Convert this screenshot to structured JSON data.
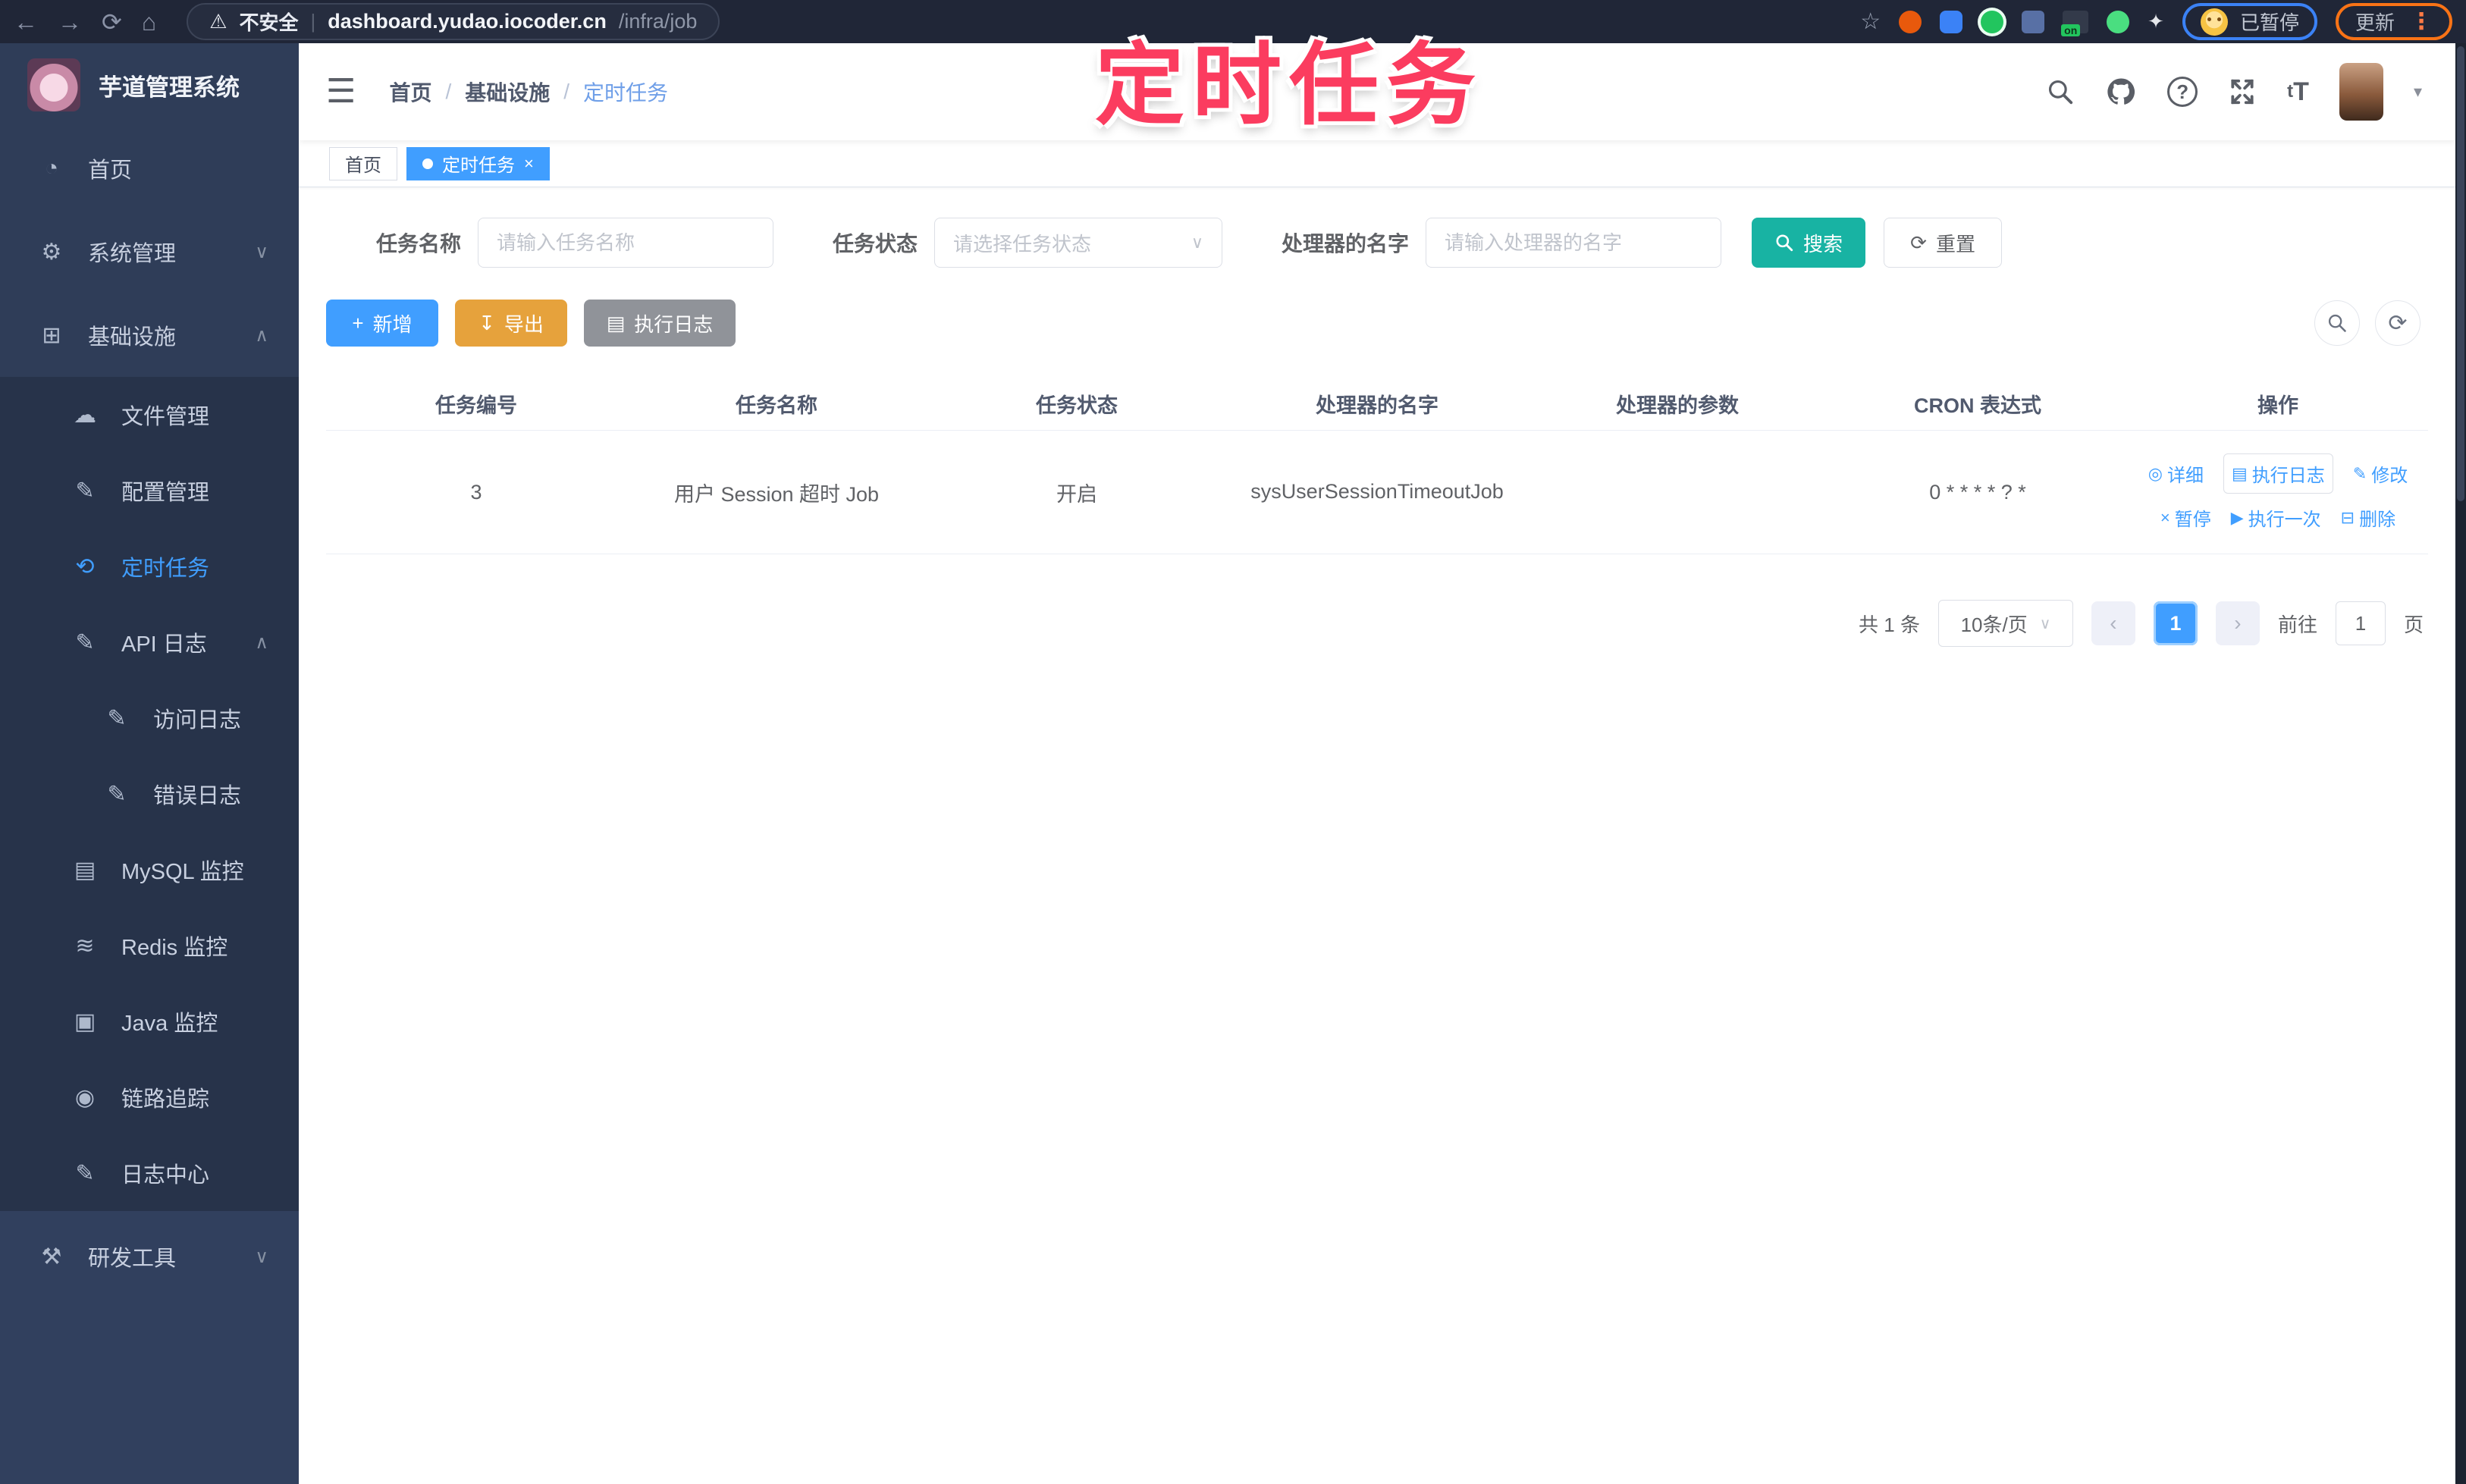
{
  "browser": {
    "security_label": "不安全",
    "url_host": "dashboard.yudao.iocoder.cn",
    "url_path": "/infra/job",
    "paused_label": "已暂停",
    "update_label": "更新",
    "ext_badge": "on"
  },
  "annotation": {
    "text": "定时任务",
    "color": "#fb3c5f"
  },
  "sidebar": {
    "title": "芋道管理系统",
    "items": [
      {
        "label": "首页",
        "icon": "dashboard-icon"
      },
      {
        "label": "系统管理",
        "icon": "gear-icon"
      },
      {
        "label": "基础设施",
        "icon": "infra-icon"
      },
      {
        "label": "文件管理",
        "icon": "cloud-upload-icon"
      },
      {
        "label": "配置管理",
        "icon": "edit-icon"
      },
      {
        "label": "定时任务",
        "icon": "timer-icon"
      },
      {
        "label": "API 日志",
        "icon": "log-icon"
      },
      {
        "label": "访问日志",
        "icon": "access-log-icon"
      },
      {
        "label": "错误日志",
        "icon": "error-log-icon"
      },
      {
        "label": "MySQL 监控",
        "icon": "mysql-icon"
      },
      {
        "label": "Redis 监控",
        "icon": "redis-icon"
      },
      {
        "label": "Java 监控",
        "icon": "java-icon"
      },
      {
        "label": "链路追踪",
        "icon": "trace-icon"
      },
      {
        "label": "日志中心",
        "icon": "log-center-icon"
      },
      {
        "label": "研发工具",
        "icon": "tools-icon"
      }
    ]
  },
  "header": {
    "breadcrumb": [
      "首页",
      "基础设施",
      "定时任务"
    ]
  },
  "tabs": [
    {
      "label": "首页"
    },
    {
      "label": "定时任务"
    }
  ],
  "filters": {
    "name_label": "任务名称",
    "name_placeholder": "请输入任务名称",
    "status_label": "任务状态",
    "status_placeholder": "请选择任务状态",
    "handler_label": "处理器的名字",
    "handler_placeholder": "请输入处理器的名字",
    "search_label": "搜索",
    "reset_label": "重置"
  },
  "toolbar": {
    "add_label": "新增",
    "export_label": "导出",
    "log_label": "执行日志"
  },
  "table": {
    "columns": [
      "任务编号",
      "任务名称",
      "任务状态",
      "处理器的名字",
      "处理器的参数",
      "CRON 表达式",
      "操作"
    ],
    "rows": [
      {
        "id": "3",
        "name": "用户 Session 超时 Job",
        "status": "开启",
        "handler": "sysUserSessionTimeoutJob",
        "param": "",
        "cron": "0 * * * * ? *"
      }
    ]
  },
  "row_actions": [
    {
      "label": "详细"
    },
    {
      "label": "执行日志"
    },
    {
      "label": "修改"
    },
    {
      "label": "暂停"
    },
    {
      "label": "执行一次"
    },
    {
      "label": "删除"
    }
  ],
  "pagination": {
    "total": "共 1 条",
    "page_size": "10条/页",
    "current_page": "1",
    "goto_label": "前往",
    "goto_value": "1",
    "page_label": "页"
  },
  "colors": {
    "accent": "#409eff",
    "search_button": "#18b3a3",
    "export_button": "#e6a23c",
    "log_button": "#909399"
  }
}
